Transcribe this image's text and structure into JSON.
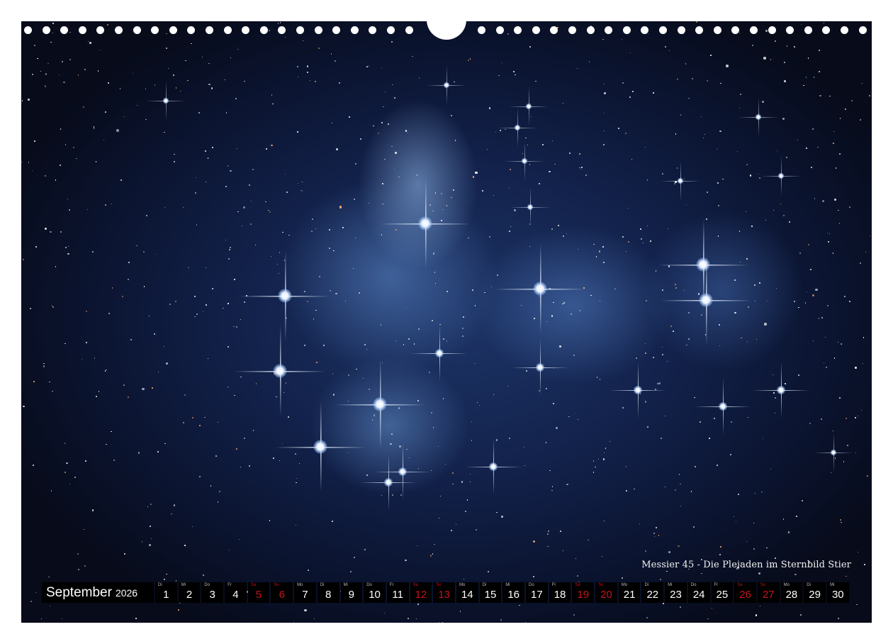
{
  "caption": "Messier 45 - Die Plejaden im Sternbild Stier",
  "calendar": {
    "month": "September",
    "year": "2026",
    "weekend_color": "#c8101e",
    "days": [
      {
        "abbr": "Di",
        "num": "1",
        "weekend": false
      },
      {
        "abbr": "Mi",
        "num": "2",
        "weekend": false
      },
      {
        "abbr": "Do",
        "num": "3",
        "weekend": false
      },
      {
        "abbr": "Fr",
        "num": "4",
        "weekend": false
      },
      {
        "abbr": "Sa",
        "num": "5",
        "weekend": true
      },
      {
        "abbr": "So",
        "num": "6",
        "weekend": true
      },
      {
        "abbr": "Mo",
        "num": "7",
        "weekend": false
      },
      {
        "abbr": "Di",
        "num": "8",
        "weekend": false
      },
      {
        "abbr": "Mi",
        "num": "9",
        "weekend": false
      },
      {
        "abbr": "Do",
        "num": "10",
        "weekend": false
      },
      {
        "abbr": "Fr",
        "num": "11",
        "weekend": false
      },
      {
        "abbr": "Sa",
        "num": "12",
        "weekend": true
      },
      {
        "abbr": "So",
        "num": "13",
        "weekend": true
      },
      {
        "abbr": "Mo",
        "num": "14",
        "weekend": false
      },
      {
        "abbr": "Di",
        "num": "15",
        "weekend": false
      },
      {
        "abbr": "Mi",
        "num": "16",
        "weekend": false
      },
      {
        "abbr": "Do",
        "num": "17",
        "weekend": false
      },
      {
        "abbr": "Fr",
        "num": "18",
        "weekend": false
      },
      {
        "abbr": "Sa",
        "num": "19",
        "weekend": true
      },
      {
        "abbr": "So",
        "num": "20",
        "weekend": true
      },
      {
        "abbr": "Mo",
        "num": "21",
        "weekend": false
      },
      {
        "abbr": "Di",
        "num": "22",
        "weekend": false
      },
      {
        "abbr": "Mi",
        "num": "23",
        "weekend": false
      },
      {
        "abbr": "Do",
        "num": "24",
        "weekend": false
      },
      {
        "abbr": "Fr",
        "num": "25",
        "weekend": false
      },
      {
        "abbr": "Sa",
        "num": "26",
        "weekend": true
      },
      {
        "abbr": "So",
        "num": "27",
        "weekend": true
      },
      {
        "abbr": "Mo",
        "num": "28",
        "weekend": false
      },
      {
        "abbr": "Di",
        "num": "29",
        "weekend": false
      },
      {
        "abbr": "Mi",
        "num": "30",
        "weekend": false
      }
    ]
  }
}
